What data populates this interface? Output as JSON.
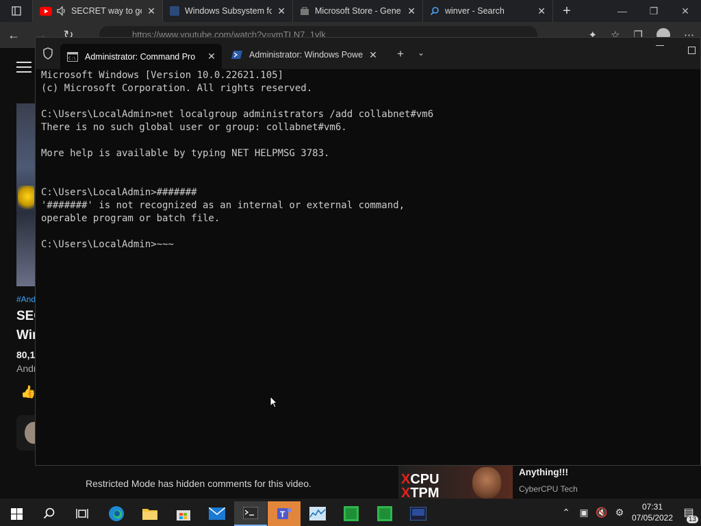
{
  "browser": {
    "tabs": [
      {
        "label": "SECRET way to get",
        "close": "✕",
        "icon": "youtube-icon",
        "audio": "speaker-icon"
      },
      {
        "label": "Windows Subsystem fo",
        "close": "✕",
        "icon": "windows-subsystem-icon"
      },
      {
        "label": "Microsoft Store - Gene",
        "close": "✕",
        "icon": "store-icon"
      },
      {
        "label": "winver - Search",
        "close": "✕",
        "icon": "search-icon"
      }
    ],
    "new_tab": "+",
    "url": "https://www.youtube.com/watch?v=vmTLN7_1ylk"
  },
  "youtube": {
    "hashtag": "#Andr",
    "title_line1": "SEC",
    "title_line2": "Win",
    "views": "80,1",
    "channel": "Andr",
    "restricted_notice": "Restricted Mode has hidden comments for this video.",
    "rec_title": "Anything!!!",
    "rec_channel": "CyberCPU Tech",
    "rec_thumb_line1": "CPU",
    "rec_thumb_line2": "TPM",
    "rec_thumb_mark": "X"
  },
  "terminal": {
    "tabs": [
      {
        "label": "Administrator: Command Pro",
        "close": "✕"
      },
      {
        "label": "Administrator: Windows Power",
        "close": "✕"
      }
    ],
    "new_tab": "+",
    "dropdown": "⌄",
    "output": "Microsoft Windows [Version 10.0.22621.105]\n(c) Microsoft Corporation. All rights reserved.\n\nC:\\Users\\LocalAdmin>net localgroup administrators /add collabnet#vm6\nThere is no such global user or group: collabnet#vm6.\n\nMore help is available by typing NET HELPMSG 3783.\n\n\nC:\\Users\\LocalAdmin>#######\n'#######' is not recognized as an internal or external command,\noperable program or batch file.\n\nC:\\Users\\LocalAdmin>~~~"
  },
  "taskbar": {
    "clock_time": "07:31",
    "clock_date": "07/05/2022",
    "notification_count": "13",
    "teams_letter": "T"
  },
  "colors": {
    "terminal_bg": "#0c0c0c",
    "terminal_text": "#cccccc",
    "youtube_red": "#ff0000",
    "accent_blue": "#3ea6ff"
  }
}
